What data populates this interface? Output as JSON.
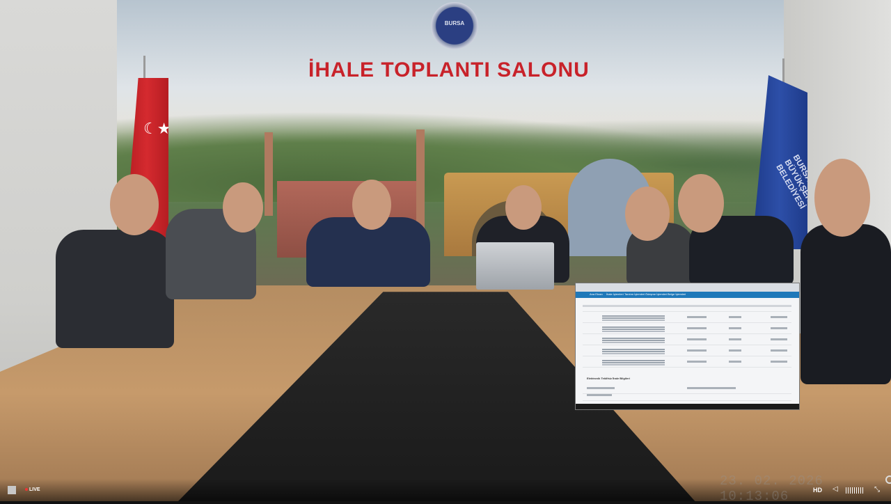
{
  "scene": {
    "room_title": "İHALE TOPLANTI SALONU",
    "logo_text": "BURSA",
    "flag_right_text": "BURSA BÜYÜKŞEHİR BELEDİYESİ",
    "flag_left_symbol": "☾★"
  },
  "overlay": {
    "nav_items": [
      "Ana Ekran",
      "İhale İşlemleri",
      "Tanıtım İşlemleri",
      "Ödeşme İşlemleri",
      "Belge İşlemleri"
    ],
    "section_title": "Elektronik Teklifsiz İhale Bilgileri"
  },
  "player": {
    "live_label": "LIVE",
    "hd_label": "HD",
    "timestamp": "23. 02. 2026  10:13:06",
    "icons": [
      "stop-icon",
      "volume-icon",
      "quality-icon",
      "fullscreen-icon"
    ]
  },
  "colors": {
    "title_red": "#c8222a",
    "bursa_blue": "#1e3b8a",
    "app_blue": "#1f78b9"
  }
}
